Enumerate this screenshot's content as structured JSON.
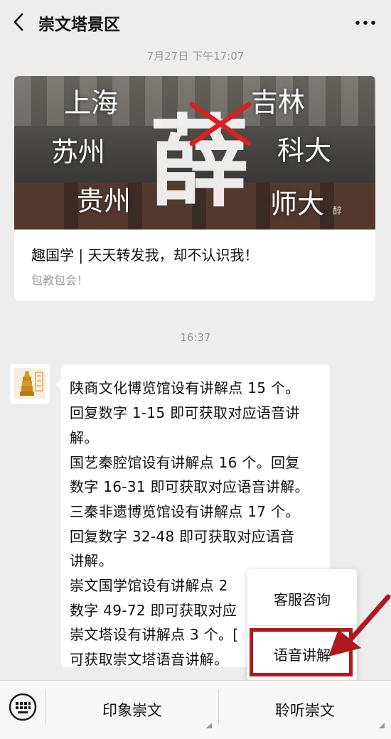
{
  "header": {
    "title": "崇文塔景区",
    "back_icon": "chevron-left-icon",
    "more_icon": "more-dots-icon"
  },
  "chat": {
    "timestamp_1": "7月27日 下午17:07",
    "article": {
      "cover_cities": [
        "上海",
        "吉林",
        "苏州",
        "科大",
        "贵州",
        "师大"
      ],
      "cover_main_glyph": "薛",
      "cover_seal": "醉",
      "title": "趣国学 | 天天转发我，却不认识我！",
      "desc": "包教包会！"
    },
    "timestamp_2": "16:37",
    "message_lines": [
      "陕商文化博览馆设有讲解点 15 个。",
      "回复数字 1-15 即可获取对应语音讲",
      "解。",
      "国艺秦腔馆设有讲解点 16 个。回复",
      "数字 16-31 即可获取对应语音讲解。",
      "三秦非遗博览馆设有讲解点 17 个。",
      "回复数字 32-48 即可获取对应语音",
      "讲解。",
      "崇文国学馆设有讲解点 2",
      "数字 49-72 即可获取对应",
      "崇文塔设有讲解点 3 个。[",
      "可获取崇文塔语音讲解。"
    ]
  },
  "popup": {
    "items": [
      "客服咨询",
      "语音讲解"
    ],
    "highlight_color": "#b01820"
  },
  "bottom_menu": {
    "keyboard_icon": "keyboard-icon",
    "items": [
      "印象崇文",
      "聆听崇文"
    ]
  }
}
